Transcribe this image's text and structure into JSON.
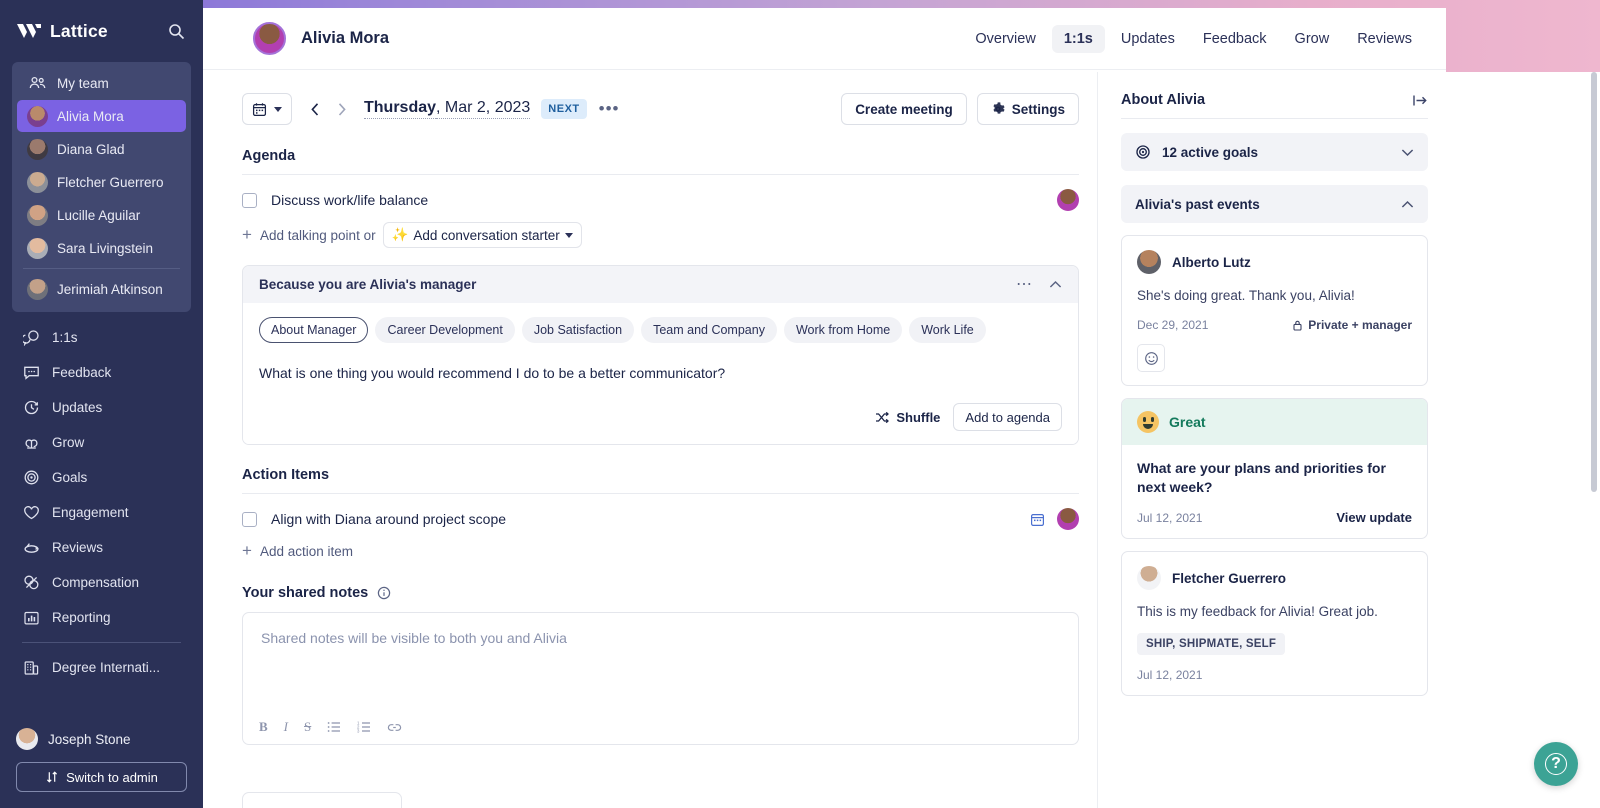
{
  "brand": {
    "name": "Lattice",
    "accent": "#7b62e3",
    "sidebar_bg": "#2b3157",
    "help_bg": "#3ca395"
  },
  "sidebar": {
    "search_icon": "search-icon",
    "team": {
      "header": {
        "label": "My team",
        "icon": "people-icon"
      },
      "members": [
        {
          "label": "Alivia Mora",
          "active": true
        },
        {
          "label": "Diana Glad",
          "active": false
        },
        {
          "label": "Fletcher Guerrero",
          "active": false
        },
        {
          "label": "Lucille Aguilar",
          "active": false
        },
        {
          "label": "Sara Livingstein",
          "active": false
        },
        {
          "label": "Jerimiah Atkinson",
          "active": false
        }
      ]
    },
    "nav": [
      {
        "label": "1:1s",
        "icon": "chat-icon"
      },
      {
        "label": "Feedback",
        "icon": "message-icon"
      },
      {
        "label": "Updates",
        "icon": "clock-icon"
      },
      {
        "label": "Grow",
        "icon": "grow-icon"
      },
      {
        "label": "Goals",
        "icon": "target-icon"
      },
      {
        "label": "Engagement",
        "icon": "heart-icon"
      },
      {
        "label": "Reviews",
        "icon": "reviews-icon"
      },
      {
        "label": "Compensation",
        "icon": "coins-icon"
      },
      {
        "label": "Reporting",
        "icon": "bar-chart-icon"
      }
    ],
    "org": {
      "label": "Degree Internati...",
      "icon": "building-icon"
    },
    "user": {
      "name": "Joseph Stone"
    },
    "admin_button": {
      "label": "Switch to admin",
      "icon": "switch-icon"
    }
  },
  "header": {
    "person": "Alivia Mora",
    "tabs": [
      {
        "label": "Overview",
        "active": false
      },
      {
        "label": "1:1s",
        "active": true
      },
      {
        "label": "Updates",
        "active": false
      },
      {
        "label": "Feedback",
        "active": false
      },
      {
        "label": "Grow",
        "active": false
      },
      {
        "label": "Reviews",
        "active": false
      }
    ]
  },
  "toolbar": {
    "calendar_icon": "calendar-icon",
    "prev_icon": "chevron-left-icon",
    "next_icon": "chevron-right-icon",
    "date_day": "Thursday",
    "date_rest": ", Mar 2, 2023",
    "next_badge": "NEXT",
    "overflow": "•••",
    "create_meeting": "Create meeting",
    "settings": "Settings"
  },
  "agenda": {
    "title": "Agenda",
    "items": [
      {
        "text": "Discuss work/life balance",
        "checked": false
      }
    ],
    "add_talking_point": "Add talking point or",
    "add_conversation_starter": "Add conversation starter",
    "sparkle": "✨"
  },
  "conversation_starter": {
    "header": "Because you are Alivia's manager",
    "chips": [
      {
        "label": "About Manager",
        "selected": true
      },
      {
        "label": "Career Development",
        "selected": false
      },
      {
        "label": "Job Satisfaction",
        "selected": false
      },
      {
        "label": "Team and Company",
        "selected": false
      },
      {
        "label": "Work from Home",
        "selected": false
      },
      {
        "label": "Work Life",
        "selected": false
      }
    ],
    "question": "What is one thing you would recommend I do to be a better communicator?",
    "shuffle": "Shuffle",
    "add_to_agenda": "Add to agenda"
  },
  "action_items": {
    "title": "Action Items",
    "items": [
      {
        "text": "Align with Diana around project scope",
        "checked": false
      }
    ],
    "add_label": "Add action item"
  },
  "notes": {
    "title": "Your shared notes",
    "info_icon": "info-icon",
    "placeholder": "Shared notes will be visible to both you and Alivia",
    "tools": [
      {
        "name": "bold-icon",
        "glyph": "B"
      },
      {
        "name": "italic-icon",
        "glyph": "I"
      },
      {
        "name": "strikethrough-icon",
        "glyph": "S"
      },
      {
        "name": "bullet-list-icon",
        "glyph": "☰"
      },
      {
        "name": "numbered-list-icon",
        "glyph": "≡"
      },
      {
        "name": "link-icon",
        "glyph": "⚭"
      }
    ]
  },
  "right_panel": {
    "title": "About Alivia",
    "collapse_icon": "collapse-panel-icon",
    "goals": {
      "label": "12 active goals",
      "icon": "target-icon",
      "expanded": false
    },
    "past_events": {
      "label": "Alivia's past events",
      "expanded": true
    },
    "events": [
      {
        "type": "feedback",
        "author": "Alberto Lutz",
        "text": "She's doing great. Thank you, Alivia!",
        "date": "Dec 29, 2021",
        "privacy": "Private + manager",
        "privacy_icon": "lock-icon",
        "reaction_icon": "emoji-icon"
      },
      {
        "type": "update",
        "status": "Great",
        "status_emoji": "smiley-face-icon",
        "question": "What are your plans and priorities for next week?",
        "date": "Jul 12, 2021",
        "action": "View update"
      },
      {
        "type": "feedback",
        "author": "Fletcher Guerrero",
        "text": "This is my feedback for Alivia! Great job.",
        "tag": "SHIP, SHIPMATE, SELF",
        "date": "Jul 12, 2021"
      }
    ]
  },
  "help_button": {
    "icon": "help-icon",
    "glyph": "?"
  }
}
